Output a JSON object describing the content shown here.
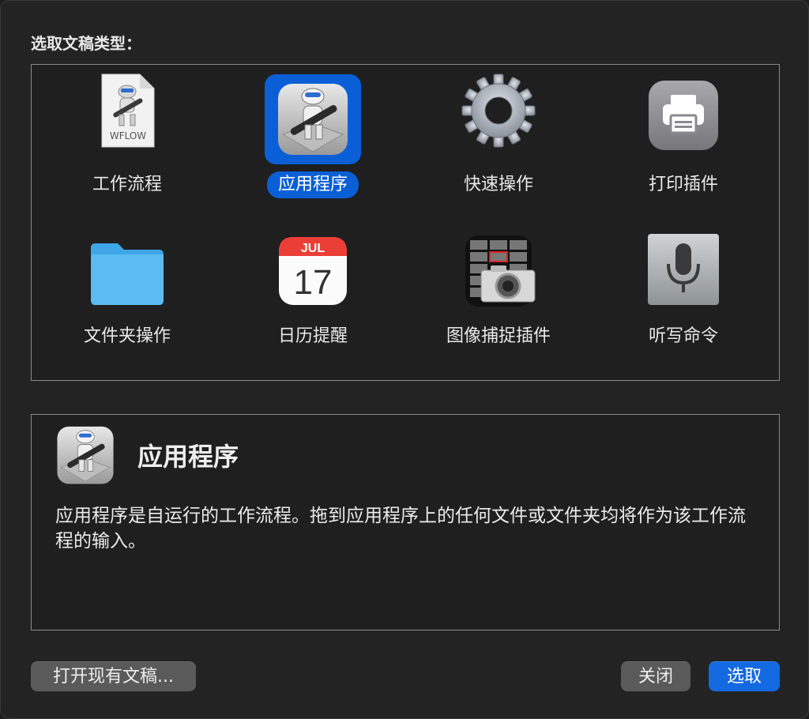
{
  "dialog": {
    "heading": "选取文稿类型："
  },
  "types": [
    {
      "label": "工作流程",
      "icon": "workflow-file-icon",
      "file_ext": "WFLOW"
    },
    {
      "label": "应用程序",
      "icon": "automator-robot-icon",
      "selected": true
    },
    {
      "label": "快速操作",
      "icon": "gear-icon"
    },
    {
      "label": "打印插件",
      "icon": "printer-icon"
    },
    {
      "label": "文件夹操作",
      "icon": "folder-icon"
    },
    {
      "label": "日历提醒",
      "icon": "calendar-icon",
      "cal_month": "JUL",
      "cal_day": "17"
    },
    {
      "label": "图像捕捉插件",
      "icon": "image-capture-icon"
    },
    {
      "label": "听写命令",
      "icon": "microphone-icon"
    }
  ],
  "description": {
    "title": "应用程序",
    "text": "应用程序是自运行的工作流程。拖到应用程序上的任何文件或文件夹均将作为该工作流程的输入。"
  },
  "buttons": {
    "open_existing": "打开现有文稿...",
    "close": "关闭",
    "choose": "选取"
  },
  "colors": {
    "selection": "#0a5fd7",
    "primary_button": "#1369e0",
    "background": "#232323"
  }
}
